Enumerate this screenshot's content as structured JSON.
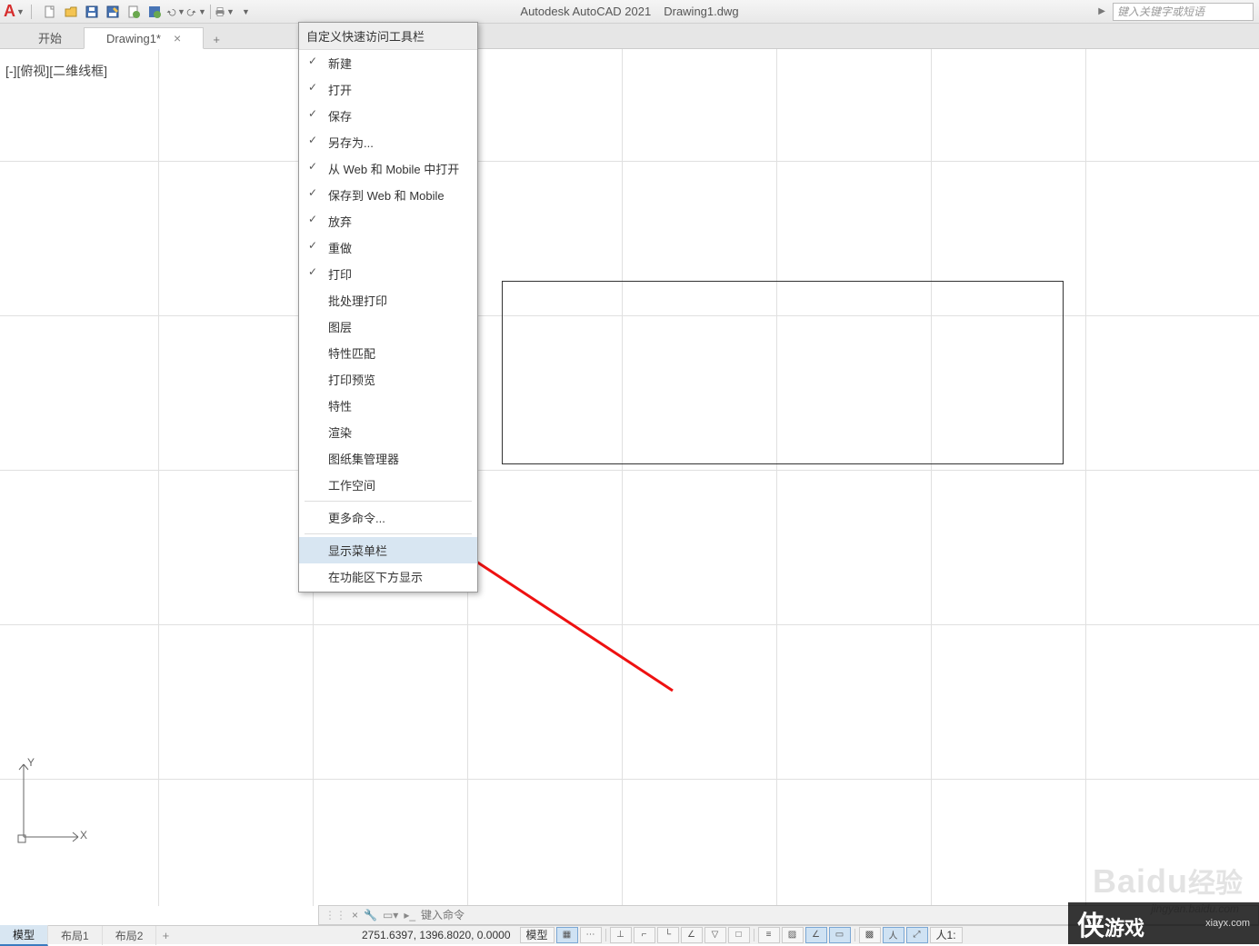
{
  "app": {
    "logo_letter": "A",
    "title_product": "Autodesk AutoCAD 2021",
    "title_file": "Drawing1.dwg"
  },
  "search": {
    "placeholder": "键入关键字或短语",
    "arrow": "▶"
  },
  "qat_icons": [
    "new-file",
    "open-file",
    "save",
    "save-as",
    "open-web",
    "save-web",
    "undo",
    "redo",
    "print",
    "dropdown"
  ],
  "tabs": {
    "start": "开始",
    "drawing_label": "Drawing1*",
    "close_glyph": "×",
    "plus_glyph": "+"
  },
  "viewport_label": "[-][俯视][二维线框]",
  "dropdown": {
    "header": "自定义快速访问工具栏",
    "checked": [
      "新建",
      "打开",
      "保存",
      "另存为...",
      "从 Web 和 Mobile 中打开",
      "保存到 Web 和 Mobile",
      "放弃",
      "重做",
      "打印"
    ],
    "unchecked": [
      "批处理打印",
      "图层",
      "特性匹配",
      "打印预览",
      "特性",
      "渲染",
      "图纸集管理器",
      "工作空间"
    ],
    "more": "更多命令...",
    "show_menu": "显示菜单栏",
    "below_ribbon": "在功能区下方显示"
  },
  "cmdline": {
    "close_glyph": "×",
    "pin_glyph": "📌",
    "wrench_glyph": "🔧",
    "chevron": "▸_",
    "placeholder": "键入命令"
  },
  "layout_tabs": {
    "model": "模型",
    "layout1": "布局1",
    "layout2": "布局2",
    "plus": "+"
  },
  "status": {
    "coords": "2751.6397, 1396.8020, 0.0000",
    "model_label": "模型",
    "zoom_suffix": "1:"
  },
  "status_icons": [
    "grid",
    "snap-mode",
    "infer",
    "dynamic-input",
    "ortho",
    "polar",
    "isometric",
    "osnap",
    "3dosnap",
    "otrack",
    "lineweight",
    "transparency",
    "cycling",
    "annotation",
    "workspace",
    "monitor",
    "units",
    "quick-props",
    "lock",
    "isolate",
    "hardware",
    "clean"
  ],
  "watermarks": {
    "baidu": "Baidu",
    "jingyan": "经验",
    "url": "jingyan.baidu.com",
    "xia": "侠",
    "game": "游戏",
    "site": "xiayx.com"
  }
}
